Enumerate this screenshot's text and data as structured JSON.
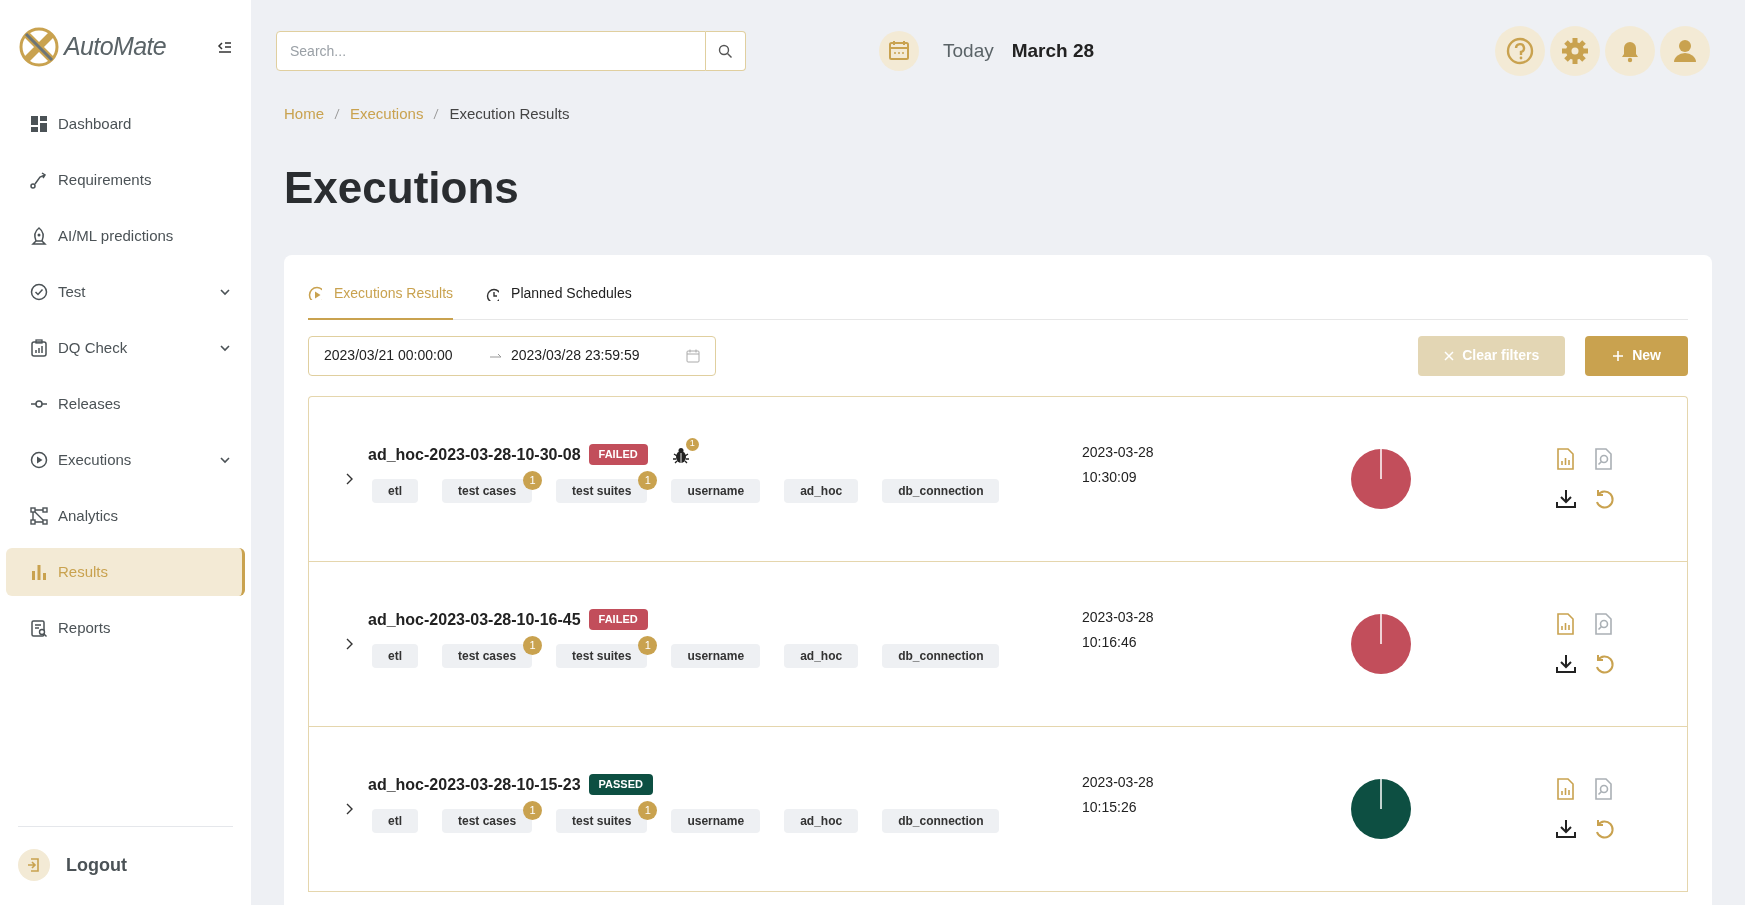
{
  "brand": {
    "name": "AutoMate"
  },
  "sidebar": {
    "items": [
      {
        "label": "Dashboard",
        "selected": false,
        "expandable": false
      },
      {
        "label": "Requirements",
        "selected": false,
        "expandable": false
      },
      {
        "label": "AI/ML predictions",
        "selected": false,
        "expandable": false
      },
      {
        "label": "Test",
        "selected": false,
        "expandable": true
      },
      {
        "label": "DQ Check",
        "selected": false,
        "expandable": true
      },
      {
        "label": "Releases",
        "selected": false,
        "expandable": false
      },
      {
        "label": "Executions",
        "selected": false,
        "expandable": true
      },
      {
        "label": "Analytics",
        "selected": false,
        "expandable": false
      },
      {
        "label": "Results",
        "selected": true,
        "expandable": false
      },
      {
        "label": "Reports",
        "selected": false,
        "expandable": false
      }
    ],
    "logout": "Logout"
  },
  "header": {
    "search": {
      "placeholder": "Search..."
    },
    "today_label": "Today",
    "date": "March 28"
  },
  "breadcrumb": [
    {
      "label": "Home",
      "link": true
    },
    {
      "label": "Executions",
      "link": true
    },
    {
      "label": "Execution Results",
      "link": false
    }
  ],
  "page_title": "Executions",
  "tabs": [
    {
      "label": "Executions Results",
      "selected": true
    },
    {
      "label": "Planned Schedules",
      "selected": false
    }
  ],
  "filters": {
    "start": "2023/03/21 00:00:00",
    "end": "2023/03/28 23:59:59",
    "clear_button": {
      "label": "Clear filters",
      "disabled": true
    },
    "new_button": "New"
  },
  "executions": [
    {
      "name": "ad_hoc-2023-03-28-10-30-08",
      "status": "FAILED",
      "bug_count": "1",
      "date": "2023-03-28",
      "time": "10:30:09",
      "tags": [
        {
          "label": "etl"
        },
        {
          "label": "test cases",
          "count": "1"
        },
        {
          "label": "test suites",
          "count": "1"
        },
        {
          "label": "username"
        },
        {
          "label": "ad_hoc"
        },
        {
          "label": "db_connection"
        }
      ]
    },
    {
      "name": "ad_hoc-2023-03-28-10-16-45",
      "status": "FAILED",
      "date": "2023-03-28",
      "time": "10:16:46",
      "tags": [
        {
          "label": "etl"
        },
        {
          "label": "test cases",
          "count": "1"
        },
        {
          "label": "test suites",
          "count": "1"
        },
        {
          "label": "username"
        },
        {
          "label": "ad_hoc"
        },
        {
          "label": "db_connection"
        }
      ]
    },
    {
      "name": "ad_hoc-2023-03-28-10-15-23",
      "status": "PASSED",
      "date": "2023-03-28",
      "time": "10:15:26",
      "tags": [
        {
          "label": "etl"
        },
        {
          "label": "test cases",
          "count": "1"
        },
        {
          "label": "test suites",
          "count": "1"
        },
        {
          "label": "username"
        },
        {
          "label": "ad_hoc"
        },
        {
          "label": "db_connection"
        }
      ]
    }
  ]
}
